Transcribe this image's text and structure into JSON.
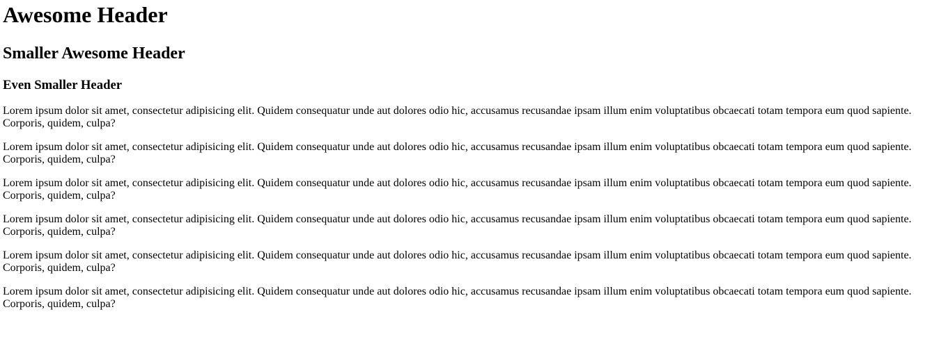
{
  "headings": {
    "h1": "Awesome Header",
    "h2": "Smaller Awesome Header",
    "h3": "Even Smaller Header"
  },
  "paragraphs": [
    "Lorem ipsum dolor sit amet, consectetur adipisicing elit. Quidem consequatur unde aut dolores odio hic, accusamus recusandae ipsam illum enim voluptatibus obcaecati totam tempora eum quod sapiente. Corporis, quidem, culpa?",
    "Lorem ipsum dolor sit amet, consectetur adipisicing elit. Quidem consequatur unde aut dolores odio hic, accusamus recusandae ipsam illum enim voluptatibus obcaecati totam tempora eum quod sapiente. Corporis, quidem, culpa?",
    "Lorem ipsum dolor sit amet, consectetur adipisicing elit. Quidem consequatur unde aut dolores odio hic, accusamus recusandae ipsam illum enim voluptatibus obcaecati totam tempora eum quod sapiente. Corporis, quidem, culpa?",
    "Lorem ipsum dolor sit amet, consectetur adipisicing elit. Quidem consequatur unde aut dolores odio hic, accusamus recusandae ipsam illum enim voluptatibus obcaecati totam tempora eum quod sapiente. Corporis, quidem, culpa?",
    "Lorem ipsum dolor sit amet, consectetur adipisicing elit. Quidem consequatur unde aut dolores odio hic, accusamus recusandae ipsam illum enim voluptatibus obcaecati totam tempora eum quod sapiente. Corporis, quidem, culpa?",
    "Lorem ipsum dolor sit amet, consectetur adipisicing elit. Quidem consequatur unde aut dolores odio hic, accusamus recusandae ipsam illum enim voluptatibus obcaecati totam tempora eum quod sapiente. Corporis, quidem, culpa?"
  ]
}
